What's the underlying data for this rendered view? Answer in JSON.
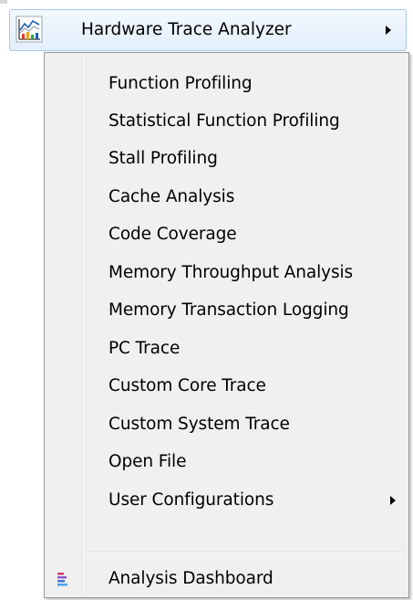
{
  "parent_menu": {
    "label": "Hardware Trace Analyzer",
    "icon": "line-chart-icon",
    "has_submenu": true
  },
  "submenu": {
    "items": [
      {
        "label": "Function Profiling"
      },
      {
        "label": "Statistical Function Profiling"
      },
      {
        "label": "Stall Profiling"
      },
      {
        "label": "Cache Analysis"
      },
      {
        "label": "Code Coverage"
      },
      {
        "label": "Memory Throughput Analysis"
      },
      {
        "label": "Memory Transaction Logging"
      },
      {
        "label": "PC Trace"
      },
      {
        "label": "Custom Core Trace"
      },
      {
        "label": "Custom System Trace"
      },
      {
        "label": "Open File"
      },
      {
        "label": "User Configurations",
        "has_submenu": true
      }
    ],
    "footer_item": {
      "label": "Analysis Dashboard",
      "icon": "dashboard-bars-icon"
    }
  },
  "colors": {
    "menu_background": "#f0f0f0",
    "highlight_border": "#a8c8ea",
    "highlight_fill": "#e3effc",
    "menu_border": "#979797"
  }
}
